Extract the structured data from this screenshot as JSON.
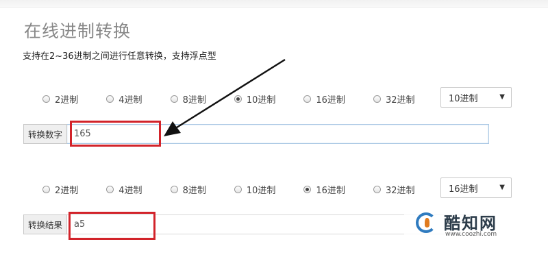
{
  "page": {
    "title": "在线进制转换",
    "subtitle": "支持在2~36进制之间进行任意转换，支持浮点型"
  },
  "input_section": {
    "bases": [
      {
        "label": "2进制",
        "checked": false
      },
      {
        "label": "4进制",
        "checked": false
      },
      {
        "label": "8进制",
        "checked": false
      },
      {
        "label": "10进制",
        "checked": true
      },
      {
        "label": "16进制",
        "checked": false
      },
      {
        "label": "32进制",
        "checked": false
      }
    ],
    "select_value": "10进制",
    "addon_label": "转换数字",
    "value": "165"
  },
  "output_section": {
    "bases": [
      {
        "label": "2进制",
        "checked": false
      },
      {
        "label": "4进制",
        "checked": false
      },
      {
        "label": "8进制",
        "checked": false
      },
      {
        "label": "10进制",
        "checked": false
      },
      {
        "label": "16进制",
        "checked": true
      },
      {
        "label": "32进制",
        "checked": false
      }
    ],
    "select_value": "16进制",
    "addon_label": "转换结果",
    "value": "a5"
  },
  "watermark": {
    "name": "酷知网",
    "url": "www.coozhi.com"
  },
  "colors": {
    "highlight": "#d2232a",
    "arrow": "#111111",
    "brand_blue": "#2f7bbf",
    "brand_orange": "#e07b1f"
  },
  "icons": {
    "select_caret": "▼"
  }
}
